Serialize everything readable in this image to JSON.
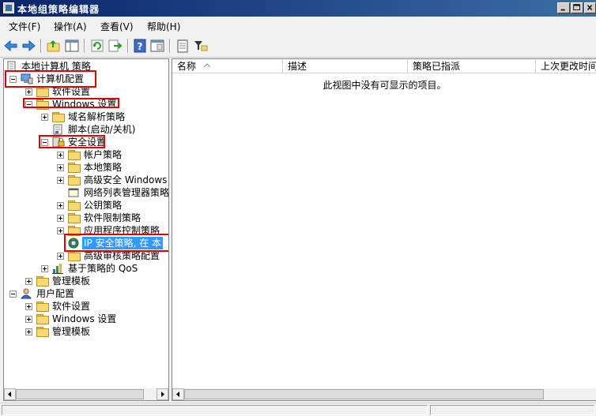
{
  "window": {
    "title": "本地组策略编辑器"
  },
  "menu": [
    "文件(F)",
    "操作(A)",
    "查看(V)",
    "帮助(H)"
  ],
  "toolbar": [
    "back-icon",
    "forward-icon",
    "up-folder-icon",
    "show-hide-tree-icon",
    "refresh-icon",
    "export-list-icon",
    "help-icon",
    "properties-icon",
    "notepad-icon",
    "filter-icon"
  ],
  "tree": {
    "root": "本地计算机 策略",
    "computer_config": "计算机配置",
    "software_settings": "软件设置",
    "windows_settings": "Windows 设置",
    "name_resolution_policy": "域名解析策略",
    "scripts": "脚本(启动/关机)",
    "security_settings": "安全设置",
    "account_policies": "帐户策略",
    "local_policies": "本地策略",
    "advanced_firewall": "高级安全 Windows 防",
    "network_list": "网络列表管理器策略",
    "public_key": "公钥策略",
    "software_restriction": "软件限制策略",
    "applocker": "应用程序控制策略",
    "ipsec": "IP 安全策略, 在 本",
    "advanced_audit": "高级审核策略配置",
    "qos": "基于策略的 QoS",
    "admin_templates": "管理模板",
    "user_config": "用户配置",
    "user_software_settings": "软件设置",
    "user_windows_settings": "Windows 设置",
    "user_admin_templates": "管理模板"
  },
  "list": {
    "columns": [
      "名称",
      "描述",
      "策略已指派",
      "上次更改时间"
    ],
    "empty_message": "此视图中没有可显示的项目。"
  },
  "colors": {
    "title_bar": "#0a246a",
    "highlight_box": "#e00000",
    "selection": "#3399ff"
  }
}
